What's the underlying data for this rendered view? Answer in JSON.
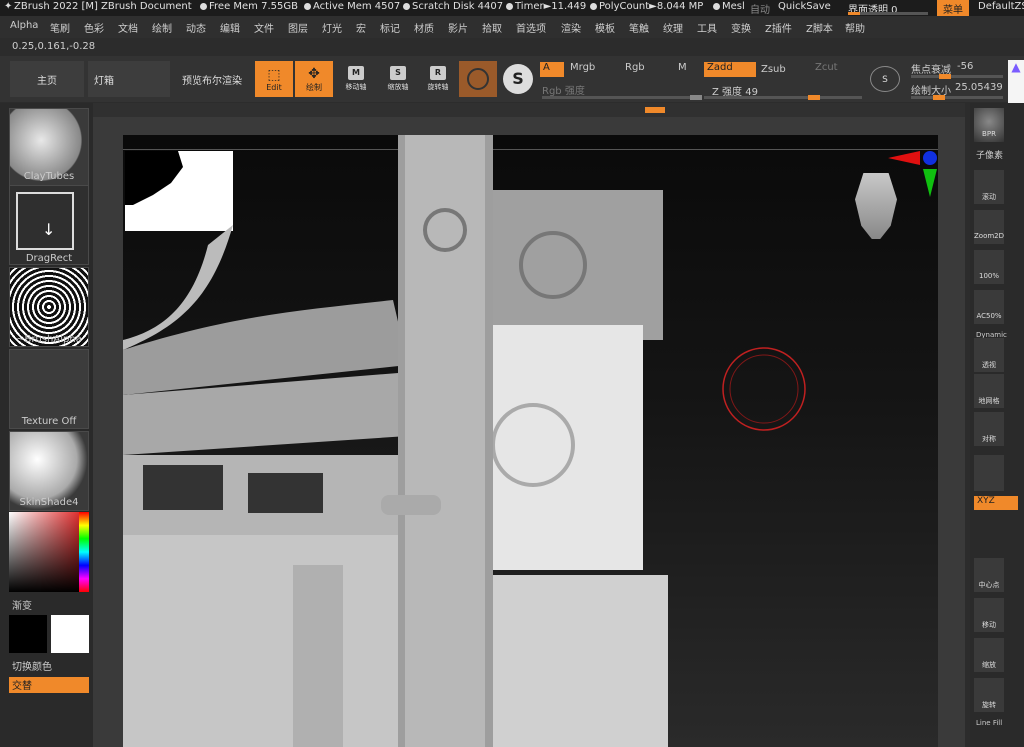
{
  "titlebar": {
    "app": "ZBrush 2022 [M]",
    "document": "ZBrush Document",
    "free_mem": "Free Mem 7.55GB",
    "active_mem": "Active Mem 4507",
    "scratch": "Scratch Disk 4407",
    "timer": "Timer►11.449",
    "polycount": "PolyCount►8.044 MP",
    "mesh": "Mesl",
    "autosave": "自动",
    "quicksave": "QuickSave",
    "transparency": "界面透明 0",
    "menu_btn": "菜单",
    "default_script": "DefaultZS"
  },
  "menubar": [
    "Alpha",
    "笔刷",
    "色彩",
    "文档",
    "绘制",
    "动态",
    "编辑",
    "文件",
    "图层",
    "灯光",
    "宏",
    "标记",
    "材质",
    "影片",
    "拾取",
    "首选项",
    "渲染",
    "模板",
    "笔触",
    "纹理",
    "工具",
    "变换",
    "Z插件",
    "Z脚本",
    "帮助"
  ],
  "coords": "0.25,0.161,-0.28",
  "shelf": {
    "home": "主页",
    "lightbox": "灯箱",
    "bpr_preview": "预览布尔渲染",
    "edit": "Edit",
    "draw": "绘制",
    "move": "移动轴",
    "scale": "缩放轴",
    "rotate": "旋转轴",
    "a": "A",
    "mrgb": "Mrgb",
    "rgb": "Rgb",
    "m": "M",
    "rgb_intensity": "Rgb 强度",
    "zadd": "Zadd",
    "zsub": "Zsub",
    "zcut": "Zcut",
    "z_intensity": "Z 强度 49",
    "focal_shift": "焦点衰减",
    "focal_val": "-56",
    "draw_size": "绘制大小",
    "draw_size_val": "25.05439"
  },
  "left": {
    "brush": "ClayTubes",
    "stroke": "DragRect",
    "alpha": "~BrushAlpha",
    "texture": "Texture Off",
    "material": "SkinShade4",
    "gradient": "渐变",
    "swap": "切换颜色",
    "alternate": "交替"
  },
  "right": {
    "bpr": "BPR",
    "subpixel": "子像素",
    "scroll": "滚动",
    "zoom2d": "Zoom2D",
    "p100": "100%",
    "ac50": "AC50%",
    "dynamic": "Dynamic",
    "persp": "透视",
    "floor": "地网格",
    "local": "对称",
    "xyz": "XYZ",
    "frame": "中心点",
    "move": "移动",
    "zoom": "缩放",
    "rotate": "旋转",
    "linefill": "Line Fill"
  },
  "colors": {
    "accent": "#f0892a",
    "bg": "#2c2c2c"
  },
  "sliders": {
    "z_intensity": 0.49,
    "draw_size": 0.5,
    "focal_shift": 0.22,
    "rgb_intensity": 0.95
  }
}
